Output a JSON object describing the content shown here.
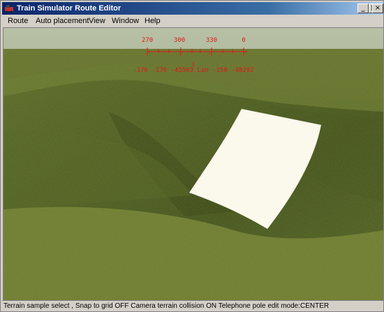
{
  "window": {
    "title": "Train Simulator Route Editor",
    "controls": {
      "minimize": "_",
      "maximize": "□",
      "close": "×"
    }
  },
  "menu": {
    "items": [
      {
        "label": "Route"
      },
      {
        "label": "Auto placement"
      },
      {
        "label": "View"
      },
      {
        "label": "Window"
      },
      {
        "label": "Help"
      }
    ]
  },
  "compass": {
    "headings": [
      "270",
      "300",
      "330",
      "0"
    ],
    "readout": "-176 -170 -45563 Lon -150 -48292"
  },
  "status": {
    "text": "Terrain sample select , Snap to grid OFF Camera terrain collision ON Telephone pole edit mode:CENTER"
  },
  "colors": {
    "title_active": "#0a246a",
    "hud": "#e01818",
    "terrain": "#5f6e28",
    "sky": "#b9c3a9"
  }
}
